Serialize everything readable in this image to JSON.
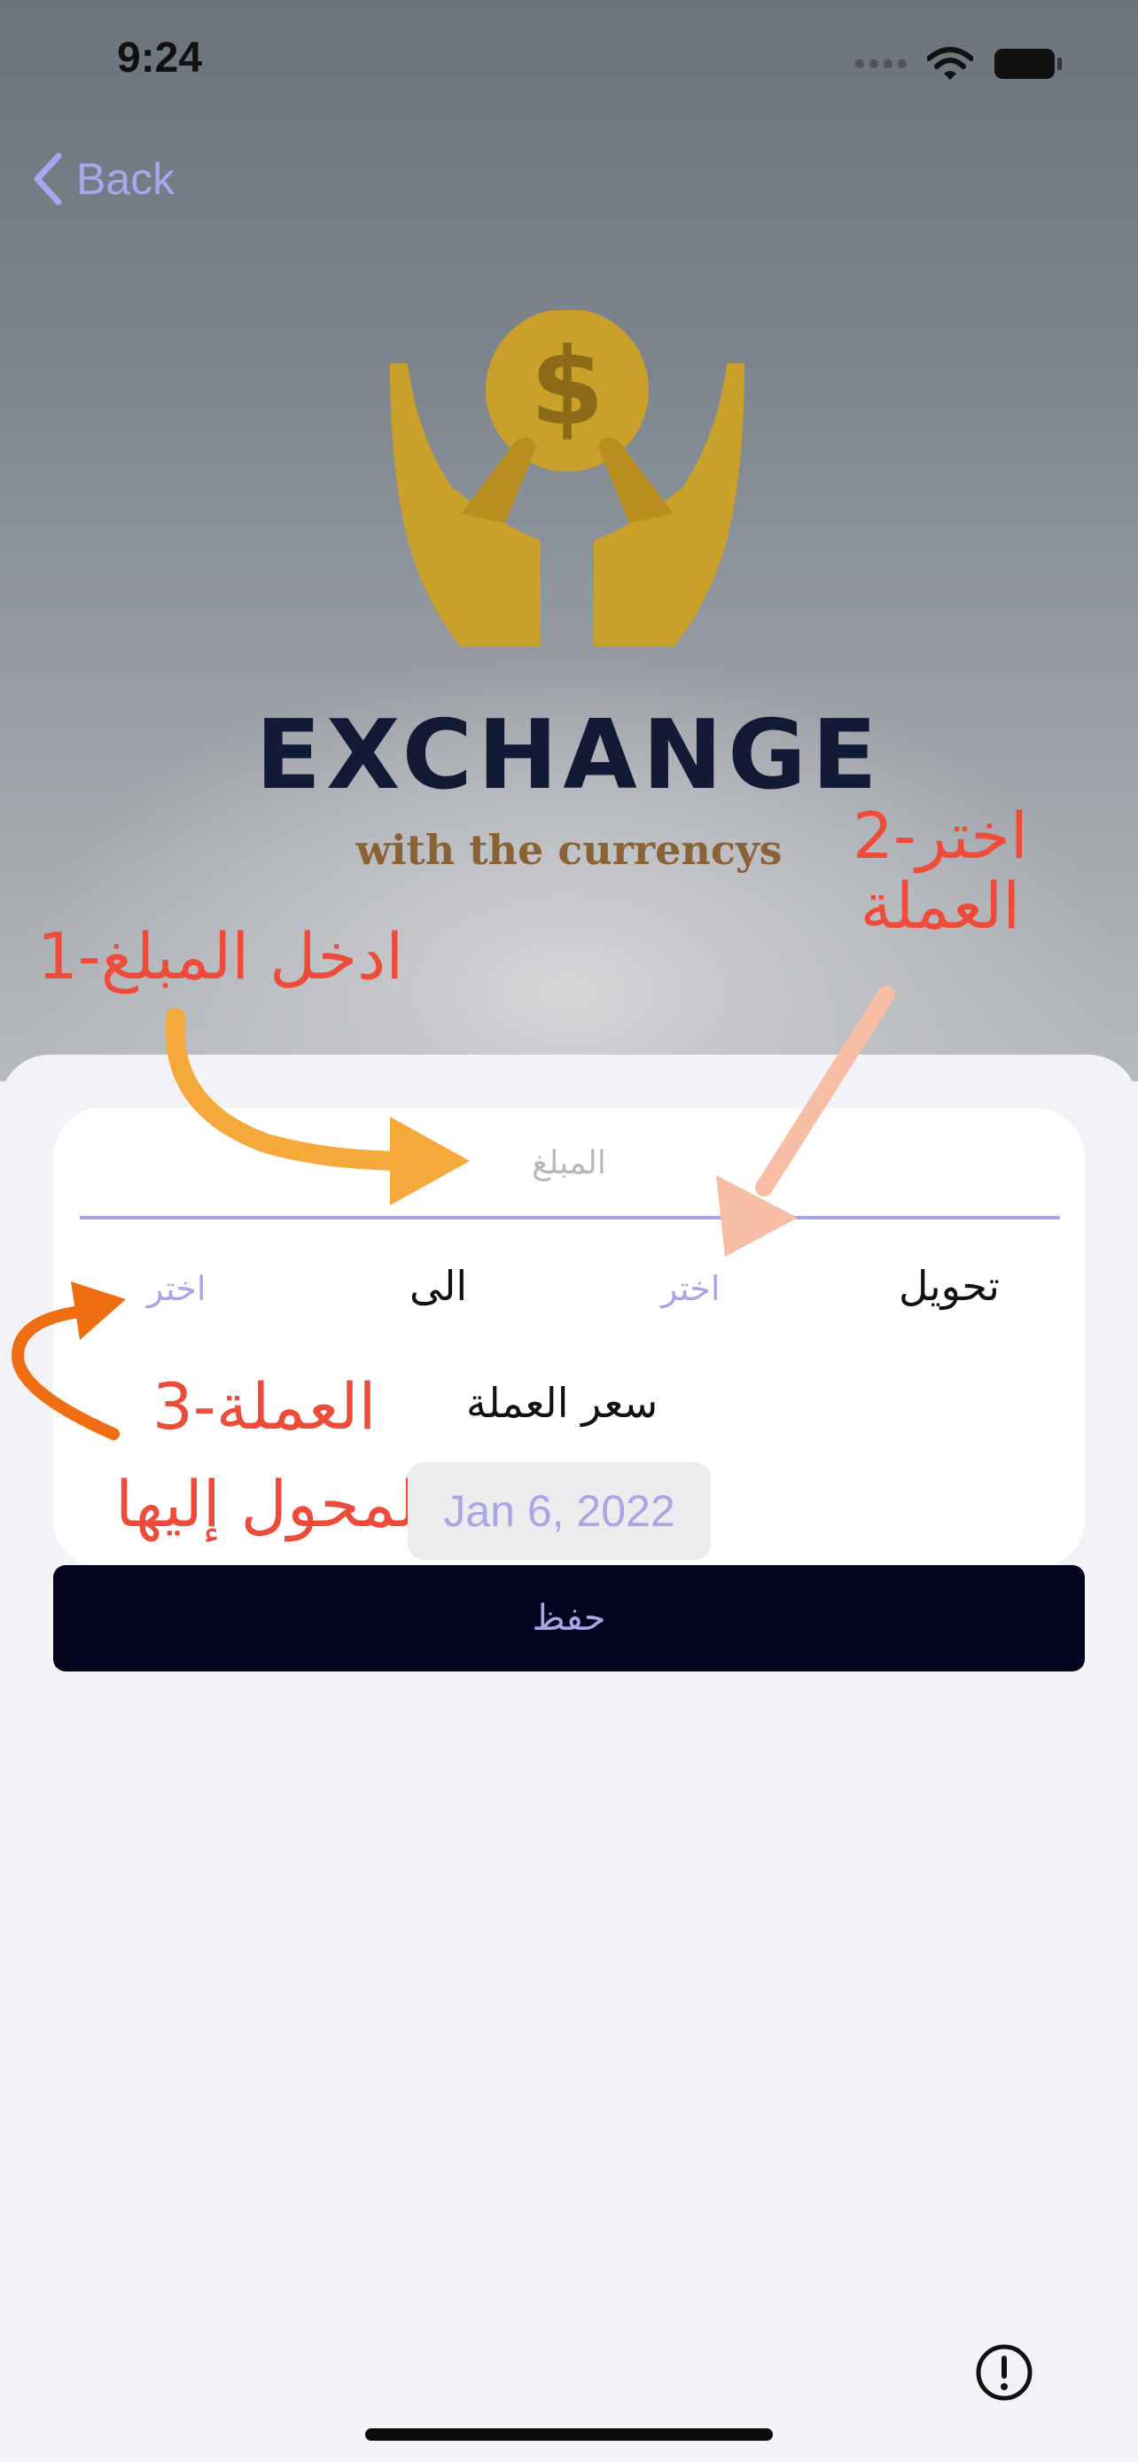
{
  "status_bar": {
    "time": "9:24"
  },
  "nav": {
    "back_label": "Back"
  },
  "brand": {
    "title": "EXCHANGE",
    "tagline": "with the currencys"
  },
  "annotations": {
    "step1": "1-ادخل المبلغ",
    "step2_line1": "2-اختر",
    "step2_line2": "العملة",
    "step3_line1": "3-العملة",
    "step3_line2": "المحول إليها"
  },
  "form": {
    "amount_placeholder": "المبلغ",
    "convert_label": "تحويل",
    "from_picker": "اختر",
    "to_label": "الى",
    "to_picker": "اختر",
    "rate_label": "سعر العملة",
    "date_value": "Jan 6, 2022",
    "save_label": "حفظ"
  },
  "colors": {
    "accent": "#A9A6E6",
    "annotation": "#EF4B3A",
    "button_bg": "#03051F",
    "brand_text": "#121A36",
    "gold": "#C9A02A"
  },
  "icons": [
    "chevron-left-icon",
    "signal-icon",
    "wifi-icon",
    "battery-icon",
    "dollar-hands-logo",
    "info-icon"
  ]
}
